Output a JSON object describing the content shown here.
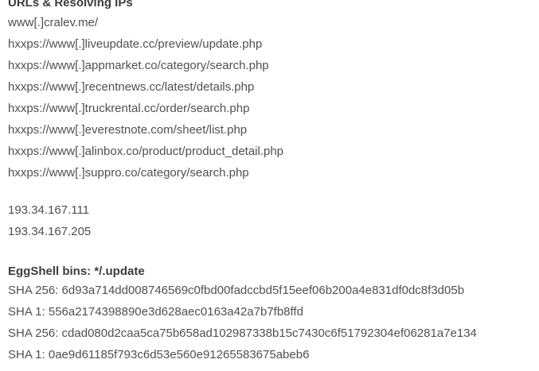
{
  "urls_section": {
    "heading": "URLs & Resolving IPs",
    "urls": [
      "www[.]cralev.me/",
      "hxxps://www[.]liveupdate.cc/preview/update.php",
      "hxxps://www[.]appmarket.co/category/search.php",
      "hxxps://www[.]recentnews.cc/latest/details.php",
      "hxxps://www[.]truckrental.cc/order/search.php",
      "hxxps://www[.]everestnote.com/sheet/list.php",
      "hxxps://www[.]alinbox.co/product/product_detail.php",
      "hxxps://www[.]suppro.co/category/search.php"
    ],
    "ips": [
      "193.34.167.111",
      "193.34.167.205"
    ]
  },
  "bins_section": {
    "heading": "EggShell bins: */.update",
    "hashes": [
      "SHA 256: 6d93a714dd008746569c0fbd00fadccbd5f15eef06b200a4e831df0dc8f3d05b",
      "SHA 1: 556a2174398890e3d628aec0163a42a7b7fb8ffd",
      "SHA 256: cdad080d2caa5ca75b658ad102987338b15c7430c6f51792304ef06281a7e134",
      "SHA 1: 0ae9d61185f793c6d53e560e91265583675abeb6"
    ]
  }
}
